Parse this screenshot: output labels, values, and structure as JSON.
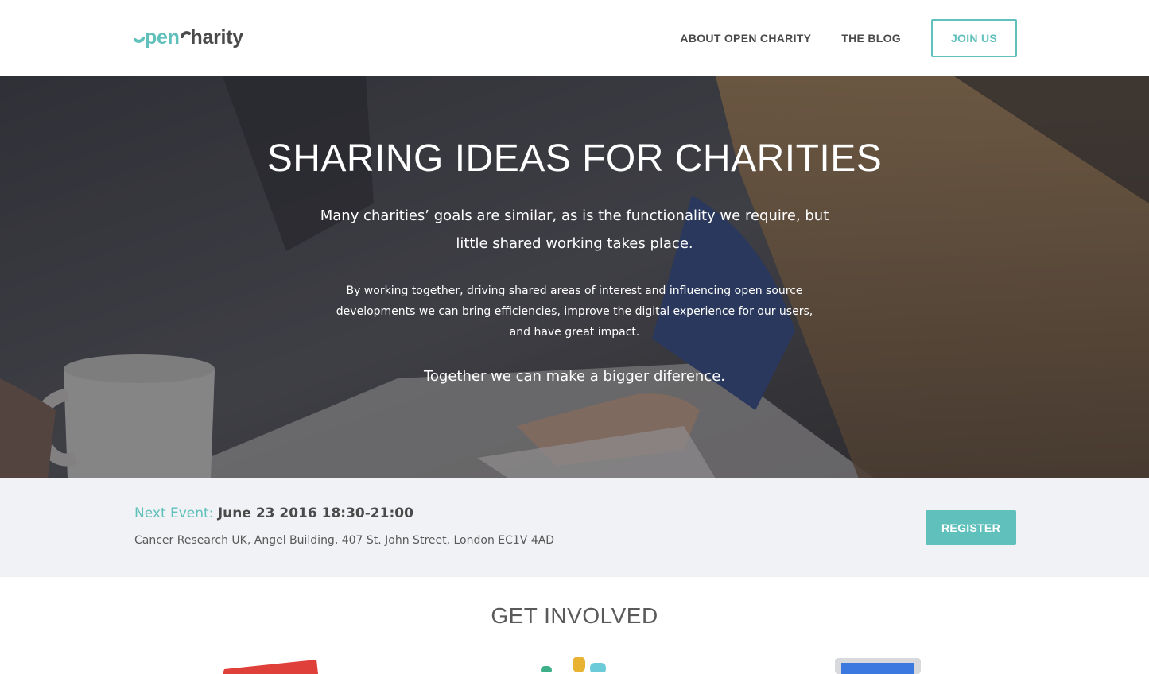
{
  "header": {
    "logo": {
      "open": "pen",
      "charity": "harity"
    },
    "nav": [
      {
        "label": "ABOUT OPEN CHARITY"
      },
      {
        "label": "THE BLOG"
      }
    ],
    "join_label": "JOIN US"
  },
  "hero": {
    "title": "SHARING IDEAS FOR CHARITIES",
    "lead": "Many charities’ goals are similar, as is the functionality we require, but little shared working takes place.",
    "body": "By working together, driving shared areas of interest and influencing open source developments we can bring efficiencies, improve the digital experience for our users, and have great impact.",
    "tagline": "Together we can make a bigger diference."
  },
  "event": {
    "label": "Next Event:",
    "date": "June 23 2016 18:30-21:00",
    "address": "Cancer Research UK, Angel Building, 407 St. John Street, London EC1V 4AD",
    "register_label": "REGISTER"
  },
  "involved": {
    "title": "GET INVOLVED"
  },
  "colors": {
    "accent": "#5fc0bc",
    "text": "#4a4a4a",
    "event_bg": "#f1f2f5"
  }
}
